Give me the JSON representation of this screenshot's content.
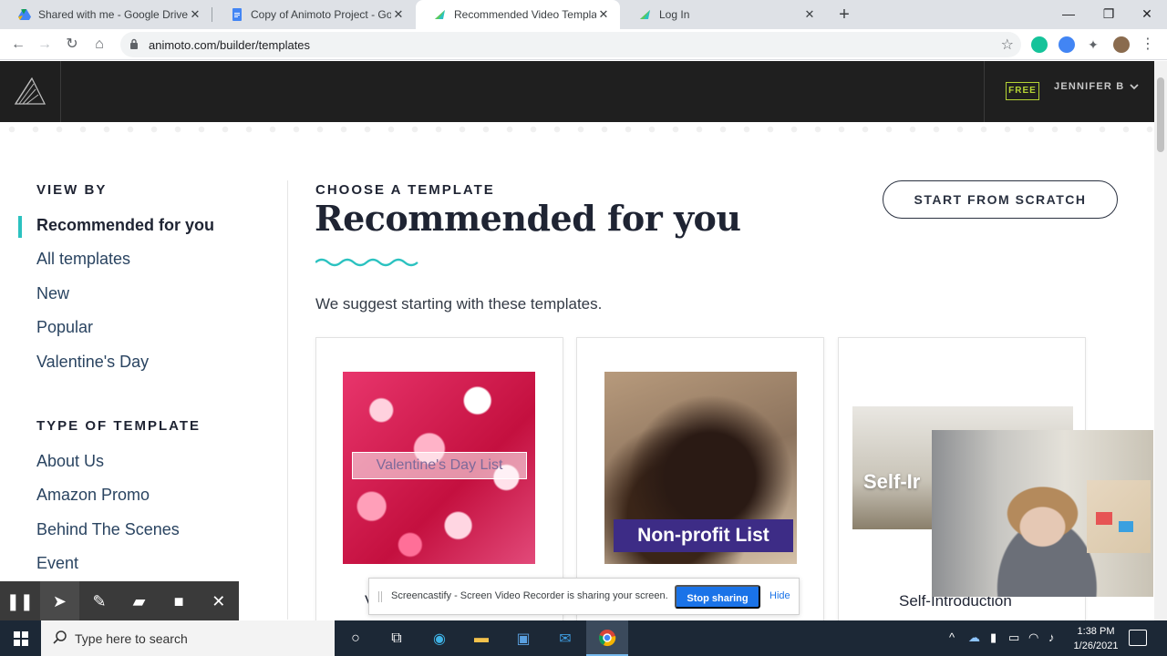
{
  "browser": {
    "tabs": [
      {
        "title": "Shared with me - Google Drive"
      },
      {
        "title": "Copy of Animoto Project - Google"
      },
      {
        "title": "Recommended Video Templates"
      },
      {
        "title": "Log In"
      }
    ],
    "url": "animoto.com/builder/templates"
  },
  "header": {
    "plan_badge": "FREE",
    "user_name": "JENNIFER B"
  },
  "sidebar": {
    "view_by_heading": "VIEW BY",
    "view_by": [
      "Recommended for you",
      "All templates",
      "New",
      "Popular",
      "Valentine's Day"
    ],
    "type_heading": "TYPE OF TEMPLATE",
    "types": [
      "About Us",
      "Amazon Promo",
      "Behind The Scenes",
      "Event"
    ]
  },
  "main": {
    "eyebrow": "CHOOSE A TEMPLATE",
    "title": "Recommended for you",
    "subtitle": "We suggest starting with these templates.",
    "start_button": "START FROM SCRATCH",
    "cards": [
      {
        "overlay": "Valentine's Day List",
        "caption": "V"
      },
      {
        "overlay": "Non-profit List",
        "caption": ""
      },
      {
        "overlay": "Self-Ir",
        "caption": "Self-Introduction"
      }
    ]
  },
  "screencastify": {
    "message": "Screencastify - Screen Video Recorder is sharing your screen.",
    "stop": "Stop sharing",
    "hide": "Hide"
  },
  "taskbar": {
    "search_placeholder": "Type here to search",
    "time": "1:38 PM",
    "date": "1/26/2021"
  },
  "colors": {
    "accent": "#2bc2c0",
    "header_bg": "#1f1f1f",
    "free_badge": "#b5d334",
    "npo_label": "#3d2c86",
    "chrome_blue": "#1a73e8"
  }
}
